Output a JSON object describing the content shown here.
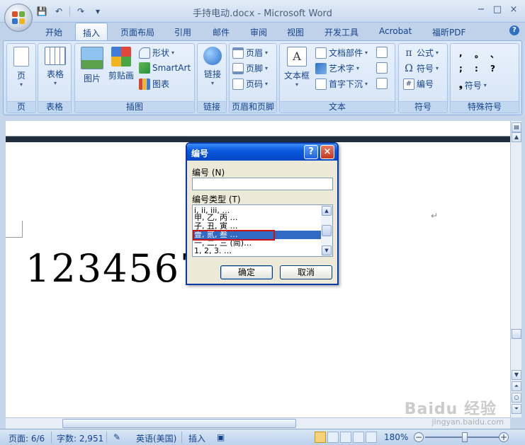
{
  "window": {
    "title": "手持电动.docx - Microsoft Word",
    "minimize": "−",
    "maximize": "□",
    "close": "×"
  },
  "qat": {
    "save": "💾",
    "undo": "↶",
    "redo": "↷",
    "more": "▾"
  },
  "tabs": [
    {
      "label": "开始"
    },
    {
      "label": "插入",
      "active": true
    },
    {
      "label": "页面布局"
    },
    {
      "label": "引用"
    },
    {
      "label": "邮件"
    },
    {
      "label": "审阅"
    },
    {
      "label": "视图"
    },
    {
      "label": "开发工具"
    },
    {
      "label": "Acrobat"
    },
    {
      "label": "福昕PDF"
    }
  ],
  "ribbon": {
    "groups": {
      "page": {
        "label": "页",
        "btn": "页"
      },
      "table": {
        "label": "表格",
        "btn": "表格"
      },
      "illustrations": {
        "label": "插图",
        "picture": "图片",
        "clipart": "剪贴画",
        "shapes": "形状",
        "smartart": "SmartArt",
        "chart": "图表"
      },
      "links": {
        "label": "链接",
        "btn": "链接"
      },
      "header_footer": {
        "label": "页眉和页脚",
        "header": "页眉",
        "footer": "页脚",
        "page_number": "页码"
      },
      "text": {
        "label": "文本",
        "textbox": "文本框",
        "quickparts": "文档部件",
        "wordart": "艺术字",
        "dropcap": "首字下沉"
      },
      "symbols": {
        "label": "符号",
        "equation": "公式",
        "symbol": "符号",
        "numbering": "编号"
      },
      "special": {
        "label": "特殊符号",
        "symbols": [
          ",",
          "。",
          "、",
          ";",
          ":",
          "?"
        ],
        "more": "符号"
      }
    }
  },
  "document": {
    "text": "12345678",
    "para_mark": "↵"
  },
  "dialog": {
    "title": "编号",
    "help": "?",
    "close": "×",
    "number_label": "编号 (N)",
    "number_value": "",
    "type_label": "编号类型 (T)",
    "types": [
      "i, ii, iii, …",
      "甲, 乙, 丙 …",
      "子, 丑, 寅 …",
      "壹, 贰, 叁 …",
      "一, 二, 三 (简)…",
      "1, 2, 3. …"
    ],
    "selected_index": 3,
    "ok": "确定",
    "cancel": "取消"
  },
  "status": {
    "page": "页面: 6/6",
    "words": "字数: 2,951",
    "language": "英语(美国)",
    "mode": "插入",
    "zoom": "180%",
    "zoom_level_percent": 180
  },
  "watermark": {
    "text": "Baidu 经验",
    "sub": "jingyan.baidu.com"
  }
}
